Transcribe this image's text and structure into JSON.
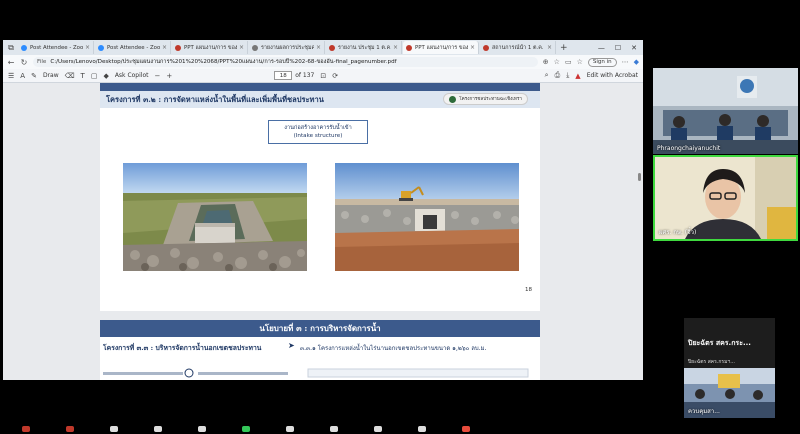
{
  "browser": {
    "tabs": [
      {
        "label": "Post Attendee - Zoom",
        "favicon_color": "#2d8cff",
        "active": false
      },
      {
        "label": "Post Attendee - Zoom",
        "favicon_color": "#2d8cff",
        "active": false
      },
      {
        "label": "PPT แผนงาน/การ ของอ...",
        "favicon_color": "#c0392b",
        "active": false
      },
      {
        "label": "รายงานผลการประชุมคณ...",
        "favicon_color": "#777777",
        "active": false
      },
      {
        "label": "รายงาน ประชุม 1 ต.ค. 68_แผนการ...",
        "favicon_color": "#c0392b",
        "active": false
      },
      {
        "label": "PPT แผนงาน/การ ของอ...",
        "favicon_color": "#c0392b",
        "active": true
      },
      {
        "label": "สถานการณ์น้ำ 1 ต.ค. 68",
        "favicon_color": "#c0392b",
        "active": false
      }
    ],
    "new_tab": "+",
    "address": {
      "prefix": "File",
      "url": "C:/Users/Lenovo/Desktop/ประชุมแผนงานการ%201%20%2068/PPT%20แผนงาน/การ-รอบปี%202-68-ของอัน-final_pagenumber.pdf"
    },
    "sign_in": "Sign in",
    "pdf_toolbar": {
      "draw_label": "Draw",
      "ask_copilot": "Ask Copilot",
      "page_current": "18",
      "page_total": "of 137",
      "edit_acrobat": "Edit with Acrobat"
    }
  },
  "slide1": {
    "project_title": "โครงการที่ ๓.๒ : การจัดหาแหล่งน้ำในพื้นที่และเพิ่มพื้นที่ชลประทาน",
    "badge": "โครงการชลประทานฉะเชิงเทรา",
    "intake_line1": "งานก่อสร้างอาคารรับน้ำเข้า",
    "intake_line2": "(Intake structure)",
    "page_number": "18"
  },
  "slide2": {
    "policy_title": "นโยบายที่ ๓ : การบริหารจัดการน้ำ",
    "project_left": "โครงการที่ ๓.๓ : บริหารจัดการน้ำนอกเขตชลประทาน",
    "arrow": "➤",
    "project_right": "๓.๓.๑ โครงการแหล่งน้ำในไร่นานอกเขตชลประทานขนาด ๑,๒๖๐ ลบ.ม."
  },
  "participants": {
    "p1_name": "Phraongchaiyanuchit",
    "p2_name": "ผศร. กษ. (จิ๋ว)",
    "p3_name": "ปิยะฉัตร สคร.กระ...",
    "p3_sub": "ปิยะฉัตร สคร.กรมฯ...",
    "p3_caption": "ควบคุมสา..."
  },
  "colors": {
    "accent_blue": "#3c5a8c",
    "slide_bar": "#dde6f1",
    "active_speaker": "#3fd93f"
  }
}
